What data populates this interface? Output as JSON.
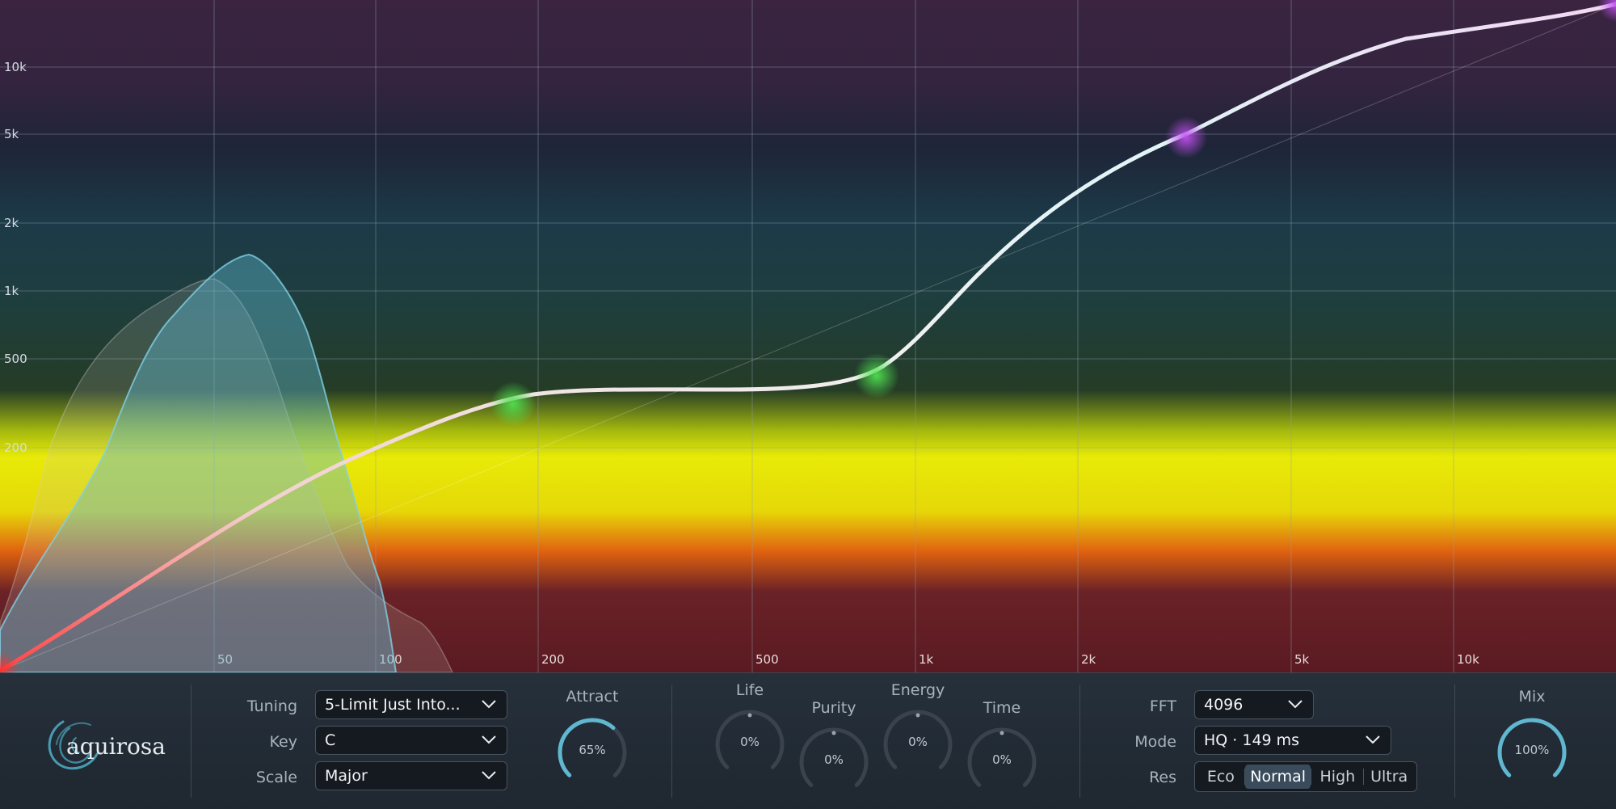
{
  "visualizer": {
    "y_axis_labels": [
      "10k",
      "5k",
      "2k",
      "1k",
      "500",
      "200"
    ],
    "x_axis_labels": [
      "50",
      "100",
      "200",
      "500",
      "1k",
      "2k",
      "5k",
      "10k"
    ]
  },
  "brand": {
    "name": "aquirosa"
  },
  "tuning": {
    "tuning_label": "Tuning",
    "tuning_value": "5-Limit Just Into...",
    "key_label": "Key",
    "key_value": "C",
    "scale_label": "Scale",
    "scale_value": "Major"
  },
  "attract": {
    "label": "Attract",
    "value": "65%",
    "level": 0.65
  },
  "character": {
    "life": {
      "label": "Life",
      "value": "0%",
      "level": 0
    },
    "purity": {
      "label": "Purity",
      "value": "0%",
      "level": 0
    },
    "energy": {
      "label": "Energy",
      "value": "0%",
      "level": 0
    },
    "time": {
      "label": "Time",
      "value": "0%",
      "level": 0
    }
  },
  "analysis": {
    "fft_label": "FFT",
    "fft_value": "4096",
    "mode_label": "Mode",
    "mode_value": "HQ · 149 ms",
    "res_label": "Res",
    "res_options": [
      "Eco",
      "Normal",
      "High",
      "Ultra"
    ],
    "res_selected": "Normal"
  },
  "mix": {
    "label": "Mix",
    "value": "100%",
    "level": 1.0
  },
  "colors": {
    "accent": "#5fb8d0",
    "curve": "#f2e6f4",
    "node_green": "#4cd04c",
    "node_purple": "#b040e0"
  }
}
